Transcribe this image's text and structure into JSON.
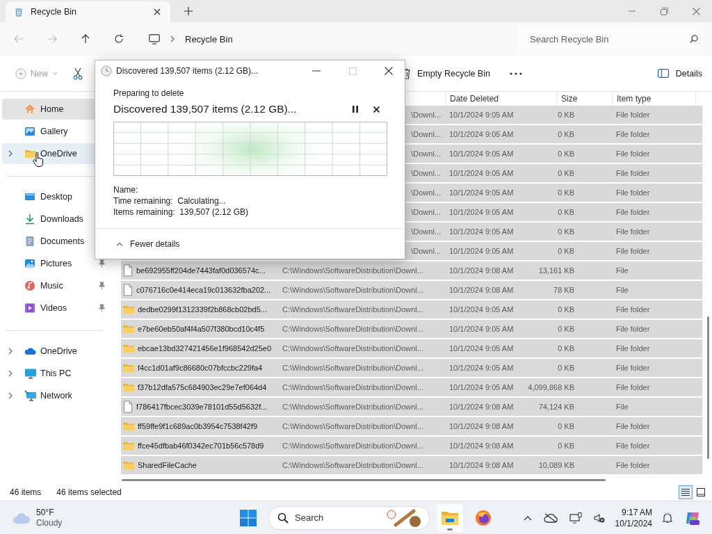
{
  "window": {
    "tab_title": "Recycle Bin"
  },
  "address_bar": {
    "breadcrumb": [
      "Recycle Bin"
    ],
    "search": {
      "placeholder": "Search Recycle Bin"
    }
  },
  "command_bar": {
    "new_button": {
      "label": "New",
      "disabled": true
    },
    "empty_button": {
      "label": "Empty Recycle Bin"
    },
    "details_button": {
      "label": "Details"
    }
  },
  "sidebar": {
    "groups": [
      {
        "items": [
          {
            "label": "Home",
            "kind": "home",
            "selected": true,
            "hovered": false,
            "expandable": false
          },
          {
            "label": "Gallery",
            "kind": "gallery",
            "selected": false,
            "hovered": false,
            "expandable": false
          },
          {
            "label": "OneDrive",
            "kind": "folder",
            "selected": false,
            "hovered": true,
            "expandable": true
          }
        ]
      },
      {
        "items": [
          {
            "label": "Desktop",
            "kind": "desktop",
            "selected": false,
            "hovered": false
          },
          {
            "label": "Downloads",
            "kind": "downloads",
            "selected": false,
            "hovered": false
          },
          {
            "label": "Documents",
            "kind": "documents",
            "selected": false,
            "hovered": false
          },
          {
            "label": "Pictures",
            "kind": "pictures",
            "selected": false,
            "hovered": false,
            "pinned": true
          },
          {
            "label": "Music",
            "kind": "music",
            "selected": false,
            "hovered": false,
            "pinned": true
          },
          {
            "label": "Videos",
            "kind": "videos",
            "selected": false,
            "hovered": false,
            "pinned": true
          }
        ]
      },
      {
        "items": [
          {
            "label": "OneDrive",
            "kind": "cloud",
            "selected": false,
            "hovered": false,
            "expandable": true
          },
          {
            "label": "This PC",
            "kind": "pc",
            "selected": false,
            "hovered": false,
            "expandable": true
          },
          {
            "label": "Network",
            "kind": "network",
            "selected": false,
            "hovered": false,
            "expandable": true
          }
        ]
      }
    ]
  },
  "file_list": {
    "columns": [
      "Date Deleted",
      "Size",
      "Item type"
    ],
    "rows": [
      {
        "selected": true,
        "location": "\\Downl...",
        "date": "10/1/2024 9:05 AM",
        "size": "0 KB",
        "type": "File folder"
      },
      {
        "selected": true,
        "location": "\\Downl...",
        "date": "10/1/2024 9:05 AM",
        "size": "0 KB",
        "type": "File folder"
      },
      {
        "selected": true,
        "location": "\\Downl...",
        "date": "10/1/2024 9:05 AM",
        "size": "0 KB",
        "type": "File folder"
      },
      {
        "selected": true,
        "location": "\\Downl...",
        "date": "10/1/2024 9:05 AM",
        "size": "0 KB",
        "type": "File folder"
      },
      {
        "selected": true,
        "location": "\\Downl...",
        "date": "10/1/2024 9:05 AM",
        "size": "0 KB",
        "type": "File folder"
      },
      {
        "selected": true,
        "location": "\\Downl...",
        "date": "10/1/2024 9:05 AM",
        "size": "0 KB",
        "type": "File folder"
      },
      {
        "selected": true,
        "location": "\\Downl...",
        "date": "10/1/2024 9:05 AM",
        "size": "0 KB",
        "type": "File folder"
      },
      {
        "selected": true,
        "location": "\\Downl...",
        "date": "10/1/2024 9:05 AM",
        "size": "0 KB",
        "type": "File folder"
      },
      {
        "selected": true,
        "kind": "file",
        "name": "be692955ff204de7443faf0d036574c...",
        "location": "C:\\Windows\\SoftwareDistribution\\Downl...",
        "date": "10/1/2024 9:08 AM",
        "size": "13,161 KB",
        "type": "File"
      },
      {
        "selected": true,
        "kind": "file",
        "name": "c076716c0e414eca19c013632fba202...",
        "location": "C:\\Windows\\SoftwareDistribution\\Downl...",
        "date": "10/1/2024 9:08 AM",
        "size": "78 KB",
        "type": "File"
      },
      {
        "selected": true,
        "kind": "folder",
        "name": "dedbe0299f1312339f2b868cb02bd5...",
        "location": "C:\\Windows\\SoftwareDistribution\\Downl...",
        "date": "10/1/2024 9:05 AM",
        "size": "0 KB",
        "type": "File folder"
      },
      {
        "selected": true,
        "kind": "folder",
        "name": "e7be60eb50af4f4a507f380bcd10c4f5",
        "location": "C:\\Windows\\SoftwareDistribution\\Downl...",
        "date": "10/1/2024 9:05 AM",
        "size": "0 KB",
        "type": "File folder"
      },
      {
        "selected": true,
        "kind": "folder",
        "name": "ebcae13bd327421456e1f968542d25e0",
        "location": "C:\\Windows\\SoftwareDistribution\\Downl...",
        "date": "10/1/2024 9:05 AM",
        "size": "0 KB",
        "type": "File folder"
      },
      {
        "selected": true,
        "kind": "folder",
        "name": "f4cc1d01af9c86680c07bfccbc229fa4",
        "location": "C:\\Windows\\SoftwareDistribution\\Downl...",
        "date": "10/1/2024 9:05 AM",
        "size": "0 KB",
        "type": "File folder"
      },
      {
        "selected": true,
        "kind": "folder",
        "name": "f37b12dfa575c684903ec29e7ef064d4",
        "location": "C:\\Windows\\SoftwareDistribution\\Downl...",
        "date": "10/1/2024 9:05 AM",
        "size": "4,099,868 KB",
        "type": "File folder"
      },
      {
        "selected": true,
        "kind": "file",
        "name": "f786417fbcec3039e78101d55d5632f...",
        "location": "C:\\Windows\\SoftwareDistribution\\Downl...",
        "date": "10/1/2024 9:08 AM",
        "size": "74,124 KB",
        "type": "File"
      },
      {
        "selected": true,
        "kind": "folder",
        "name": "ff59ffe9f1c689ac0b3954c7538f42f9",
        "location": "C:\\Windows\\SoftwareDistribution\\Downl...",
        "date": "10/1/2024 9:08 AM",
        "size": "0 KB",
        "type": "File folder"
      },
      {
        "selected": true,
        "kind": "folder",
        "name": "ffce45dfbab46f0342ec701b56c578d9",
        "location": "C:\\Windows\\SoftwareDistribution\\Downl...",
        "date": "10/1/2024 9:08 AM",
        "size": "0 KB",
        "type": "File folder"
      },
      {
        "selected": true,
        "kind": "folder",
        "name": "SharedFileCache",
        "location": "C:\\Windows\\SoftwareDistribution\\Downl...",
        "date": "10/1/2024 9:08 AM",
        "size": "10,089 KB",
        "type": "File folder"
      }
    ]
  },
  "status_bar": {
    "item_count": "46 items",
    "selection": "46 items selected",
    "views": [
      {
        "kind": "details",
        "selected": true
      },
      {
        "kind": "tiles",
        "selected": false
      }
    ]
  },
  "dialog": {
    "title": "Discovered 139,507 items (2.12 GB)...",
    "heading": "Preparing to delete",
    "status": "Discovered 139,507 items (2.12 GB)...",
    "details": [
      {
        "label": "Name:"
      },
      {
        "label": "Time remaining:",
        "value": "Calculating..."
      },
      {
        "label": "Items remaining:",
        "value": "139,507 (2.12 GB)"
      }
    ],
    "toggle": "Fewer details"
  },
  "taskbar": {
    "weather": {
      "temperature": "50°F",
      "condition": "Cloudy"
    },
    "search": {
      "placeholder": "Search"
    },
    "apps": [
      {
        "kind": "explorer",
        "active": true
      },
      {
        "kind": "firefox",
        "active": false
      }
    ],
    "clock": {
      "time": "9:17 AM",
      "date": "10/1/2024"
    }
  }
}
